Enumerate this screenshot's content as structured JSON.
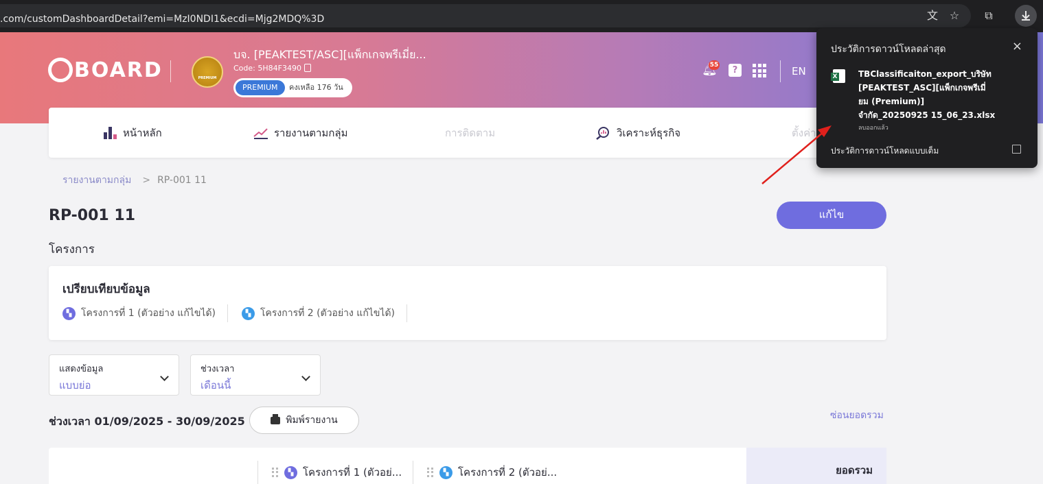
{
  "browser": {
    "url": ".com/customDashboardDetail?emi=MzI0NDI1&ecdi=Mjg2MDQ%3D",
    "icons": [
      "translate-icon",
      "star-icon",
      "extensions-icon",
      "download-icon"
    ]
  },
  "header": {
    "logo_text": "BOARD",
    "company_name": "บจ. [PEAKTEST/ASC][แพ็กเกจพรีเมี่ย...",
    "code": "Code: 5H84F3490",
    "plan_badge": "PREMIUM",
    "plan_remaining": "คงเหลือ 176 วัน",
    "crown_text": "PREMIUM",
    "notification_count": "55",
    "help_glyph": "?",
    "language": "EN"
  },
  "nav": {
    "items": [
      {
        "label": "หน้าหลัก",
        "icon": "bar-chart-icon"
      },
      {
        "label": "รายงานตามกลุ่ม",
        "icon": "trend-line-icon"
      },
      {
        "label": "การติดตาม",
        "icon": ""
      },
      {
        "label": "วิเคราะห์ธุรกิจ",
        "icon": "magnifier-chart-icon"
      },
      {
        "label": "ตั้งค่า",
        "icon": ""
      }
    ]
  },
  "breadcrumb": {
    "parent": "รายงานตามกลุ่ม",
    "sep": ">",
    "current": "RP-001 11"
  },
  "page": {
    "title": "RP-001 11",
    "edit_label": "แก้ไข",
    "section_label": "โครงการ"
  },
  "compare": {
    "title": "เปรียบเทียบข้อมูล",
    "projects": [
      {
        "label": "โครงการที่ 1 (ตัวอย่าง แก้ไขได้)",
        "color": "#6f6ddf"
      },
      {
        "label": "โครงการที่ 2 (ตัวอย่าง แก้ไขได้)",
        "color": "#3b9be8"
      }
    ]
  },
  "filters": {
    "display": {
      "label": "แสดงข้อมูล",
      "value": "แบบย่อ"
    },
    "period": {
      "label": "ช่วงเวลา",
      "value": "เดือนนี้"
    }
  },
  "period_text": "ช่วงเวลา 01/09/2025 - 30/09/2025",
  "print_label": "พิมพ์รายงาน",
  "hide_total_label": "ซ่อนยอดรวม",
  "table": {
    "columns": [
      "โครงการที่ 1 (ตัวอย่...",
      "โครงการที่ 2 (ตัวอย่..."
    ],
    "total_label": "ยอดรวม"
  },
  "download_popup": {
    "title": "ประวัติการดาวน์โหลดล่าสุด",
    "close": "×",
    "file_name": "TBClassificaiton_export_บริษัท [PEAKTEST_ASC][แพ็กเกจพรีเมี่ยม (Premium)] จำกัด_20250925 15_06_23.xlsx",
    "file_status": "ลบออกแล้ว",
    "full_history": "ประวัติการดาวน์โหลดแบบเต็ม",
    "file_icon_letter": "X"
  },
  "colors": {
    "accent": "#6f6ddf",
    "gradient_start": "#e8787b",
    "gradient_end": "#7a76d6",
    "annotation_arrow": "#e0201c"
  }
}
